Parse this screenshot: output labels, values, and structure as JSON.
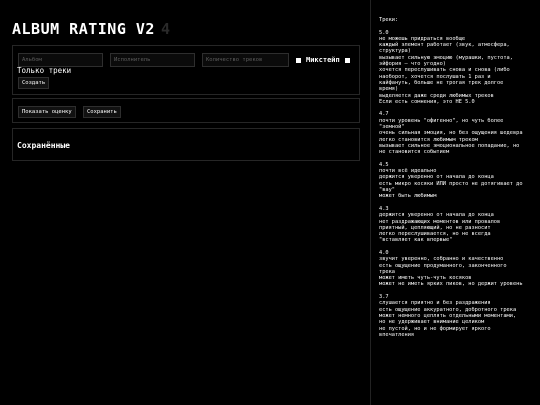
{
  "app": {
    "title": "ALBUM RATING V2",
    "title_count": "4"
  },
  "create_form": {
    "album_placeholder": "Альбом",
    "artist_placeholder": "Исполнитель",
    "tracks_placeholder": "Количество треков",
    "mixtape_label": "Микстейп",
    "only_tracks_label": "Только треки",
    "create_button": "Создать"
  },
  "actions": {
    "show_score_button": "Показать оценку",
    "save_button": "Сохранить"
  },
  "saved": {
    "title": "Сохранённые"
  },
  "sidebar": {
    "heading": "Треки:",
    "grades": [
      {
        "score": "5.0",
        "lines": [
          "не можешь придраться вообще",
          "каждый элемент работает (звук, атмосфера,",
          "структура)",
          "вызывает сильную эмоцию (мурашки, пустота,",
          "эйфория — что угодно)",
          "хочется переслушивать снова и снова (либо",
          "наоборот, хочется послушать 1 раз и",
          "кайфануть, больше не трогая трек долгое",
          "время)",
          "выделяется даже среди любимых треков",
          "Если есть сомнения, это НЕ 5.0"
        ]
      },
      {
        "score": "4.7",
        "lines": [
          "почти уровень \"офигенно\", но чуть более",
          "\"земной\"",
          "очень сильная эмоция, но без ощущения шедевра",
          "легко становится любимым треком",
          "вызывает сильное эмоциональное попадание, но",
          "не становится событием"
        ]
      },
      {
        "score": "4.5",
        "lines": [
          "почти всё идеально",
          "держится уверенно от начала до конца",
          "есть микро косяки ИЛИ просто не дотягивает до",
          "\"вау\"",
          "может быть любимым"
        ]
      },
      {
        "score": "4.3",
        "lines": [
          "держится уверенно от начала до конца",
          "нет раздражающих моментов или провалов",
          "приятный, цепляющий, но не разносит",
          "легко переслушивается, но не всегда",
          "\"вставляет как впервые\""
        ]
      },
      {
        "score": "4.0",
        "lines": [
          "звучит уверенно, собранно и качественно",
          "есть ощущение продуманного, законченного",
          "трека",
          "может иметь чуть-чуть косяков",
          "может не иметь ярких пиков, но держит уровень"
        ]
      },
      {
        "score": "3.7",
        "lines": [
          "слушается приятно и без раздражения",
          "есть ощущение аккуратного, добротного трека",
          "может немного цеплять отдельными моментами,",
          "но не удерживает внимание целиком",
          "не пустой, но и не формирует яркого",
          "впечатления"
        ]
      }
    ]
  }
}
